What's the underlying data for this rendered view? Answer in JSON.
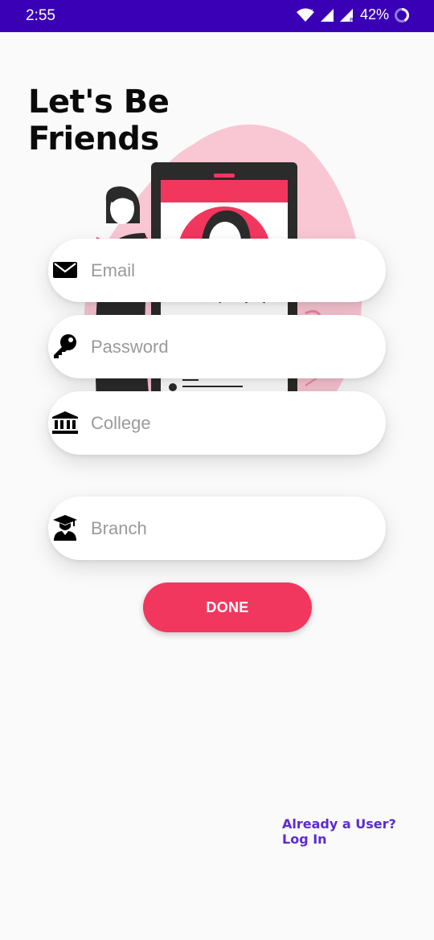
{
  "status_bar": {
    "time": "2:55",
    "battery": "42%",
    "color": "#3a00b5"
  },
  "header": {
    "title_line1": "Let's Be",
    "title_line2": "Friends"
  },
  "form": {
    "email": {
      "placeholder": "Email",
      "value": "",
      "icon": "mail-icon"
    },
    "password": {
      "placeholder": "Password",
      "value": "",
      "icon": "key-icon"
    },
    "college": {
      "placeholder": "College",
      "value": "",
      "icon": "bank-icon"
    },
    "branch": {
      "placeholder": "Branch",
      "value": "",
      "icon": "graduate-icon"
    }
  },
  "actions": {
    "done_label": "DONE",
    "login_prompt": "Already a User?",
    "login_label": "Log In"
  },
  "colors": {
    "accent": "#f2375f",
    "link": "#5b2bd0",
    "illustration_blob": "#f9c6d3"
  }
}
